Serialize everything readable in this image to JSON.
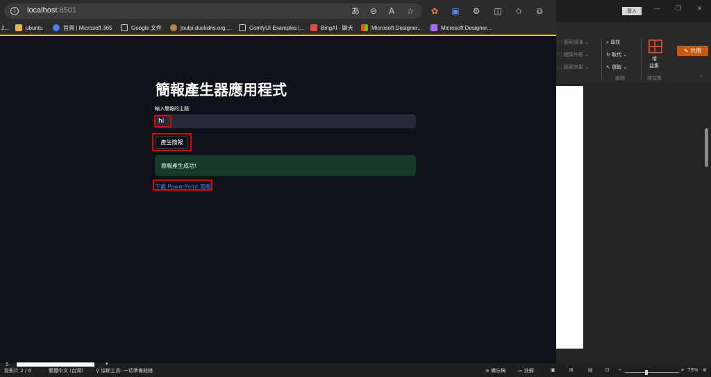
{
  "browser": {
    "url_host": "localhost",
    "url_port": ":8501",
    "bookmarks": [
      {
        "label": "2...",
        "color": "#7aa7ff"
      },
      {
        "label": "ubuntu",
        "color": "#e8b84a"
      },
      {
        "label": "首頁 | Microsoft 365",
        "color": "#4f7cff"
      },
      {
        "label": "Google 文件",
        "color": "#d0d0d0"
      },
      {
        "label": "joulpi.duckdns.org:...",
        "color": "#b58a52"
      },
      {
        "label": "ComfyUI Examples |...",
        "color": "#d0d0d0"
      },
      {
        "label": "BingAI - 聊天",
        "color": "#e24a3b"
      },
      {
        "label": "Microsoft Designer...",
        "color": "#f25022"
      },
      {
        "label": "Microsoft Designer...",
        "color": "#a36bff"
      }
    ]
  },
  "app": {
    "title": "簡報產生器應用程式",
    "input_label": "輸入簡報的主題:",
    "input_value": "hi",
    "generate_button": "產生簡報",
    "success_message": "簡報產生成功!",
    "download_link": "下載 PowerPoint 簡報"
  },
  "ppt": {
    "signin": "登入",
    "share": "共用",
    "ribbon": {
      "arrange": "圖案填滿",
      "outline": "圖案外框",
      "effects": "圖案效果",
      "find": "尋找",
      "replace": "取代",
      "select": "選取",
      "editing_group": "編輯",
      "addins": "增益集",
      "addins_line1": "增",
      "addins_line2": "益集",
      "addins_group": "增益集"
    },
    "status": {
      "slide_num": "5",
      "slide_info": "投影片 2 / 6",
      "language": "繁體中文 (台灣)",
      "accessibility": "協助工具: 一切準備就緒",
      "notes": "備忘稿",
      "comments": "註解",
      "zoom": "79%"
    }
  }
}
